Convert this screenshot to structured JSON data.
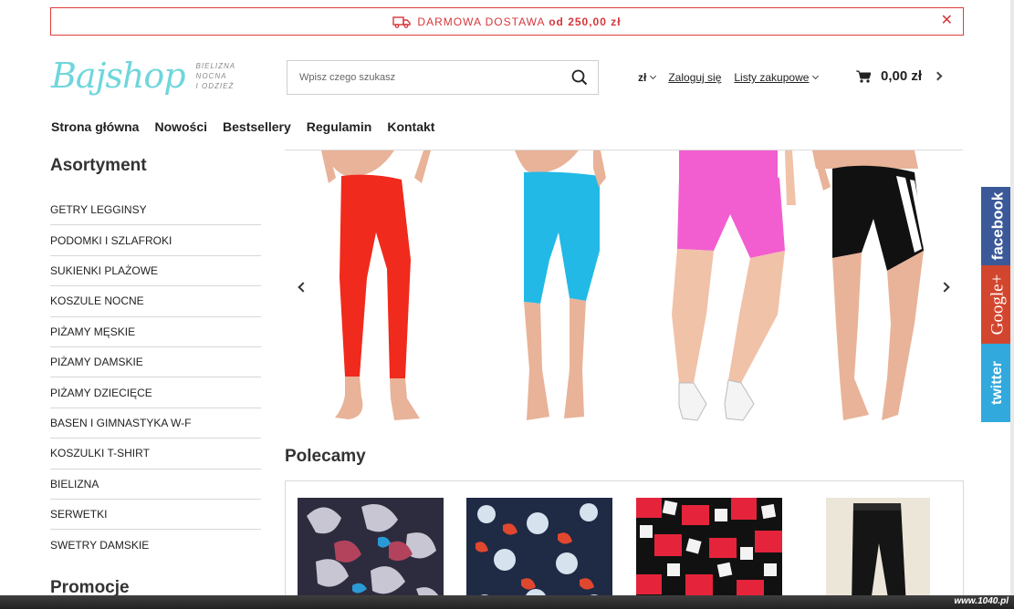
{
  "promo": {
    "text": "DARMOWA DOSTAWA",
    "bold": "od 250,00 zł",
    "close": "✕"
  },
  "logo": {
    "name": "Bajshop",
    "tagline_1": "Bielizna nocna",
    "tagline_2": "i odzież"
  },
  "search": {
    "placeholder": "Wpisz czego szukasz"
  },
  "header": {
    "currency": "zł",
    "login": "Zaloguj się",
    "lists": "Listy zakupowe"
  },
  "cart": {
    "amount": "0,00 zł"
  },
  "nav": [
    "Strona główna",
    "Nowości",
    "Bestsellery",
    "Regulamin",
    "Kontakt"
  ],
  "sidebar": {
    "title": "Asortyment",
    "items": [
      "GETRY LEGGINSY",
      "PODOMKI I SZLAFROKI",
      "SUKIENKI PLAŻOWE",
      "KOSZULE NOCNE",
      "PIŻAMY MĘSKIE",
      "PIŻAMY DAMSKIE",
      "PIŻAMY DZIECIĘCE",
      "BASEN I GIMNASTYKA W-F",
      "KOSZULKI T-SHIRT",
      "BIELIZNA",
      "SERWETKI",
      "SWETRY DAMSKIE"
    ],
    "title2": "Promocje"
  },
  "slider": {
    "colors": [
      "#f02a1c",
      "#22b9e6",
      "#f25ed0",
      "#111111"
    ]
  },
  "recommended": {
    "title": "Polecamy"
  },
  "social": {
    "facebook": "facebook",
    "google": "Google+",
    "twitter": "twitter"
  },
  "watermark": "www.1040.pl"
}
